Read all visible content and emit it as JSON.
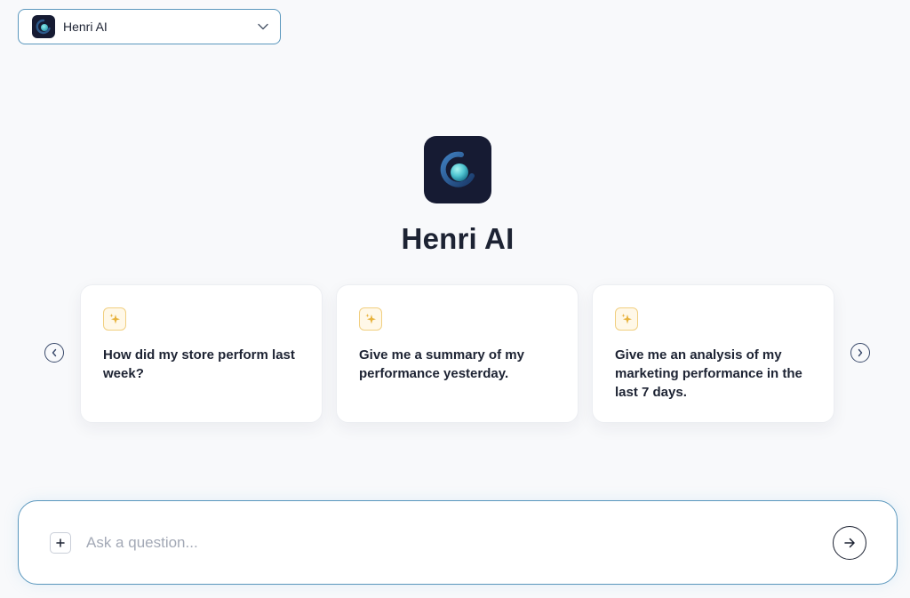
{
  "agent_selector": {
    "label": "Henri AI",
    "icon": "henri-logo-icon",
    "chevron_icon": "chevron-down-icon"
  },
  "hero": {
    "title": "Henri AI",
    "logo_icon": "henri-logo-icon"
  },
  "carousel": {
    "prev_icon": "chevron-left-icon",
    "next_icon": "chevron-right-icon",
    "cards": [
      {
        "icon": "sparkle-icon",
        "text": "How did my store perform last week?"
      },
      {
        "icon": "sparkle-icon",
        "text": "Give me a summary of my performance yesterday."
      },
      {
        "icon": "sparkle-icon",
        "text": "Give me an analysis of my marketing performance in the last 7 days."
      }
    ]
  },
  "composer": {
    "placeholder": "Ask a question...",
    "value": "",
    "attach_icon": "plus-icon",
    "send_icon": "arrow-right-icon"
  },
  "colors": {
    "background": "#f8f9fb",
    "logo_bg": "#161b33",
    "logo_accent": "#4fc4d0",
    "border_accent": "#5a97bd",
    "sparkle": "#e7b23c",
    "text": "#1d2333"
  }
}
